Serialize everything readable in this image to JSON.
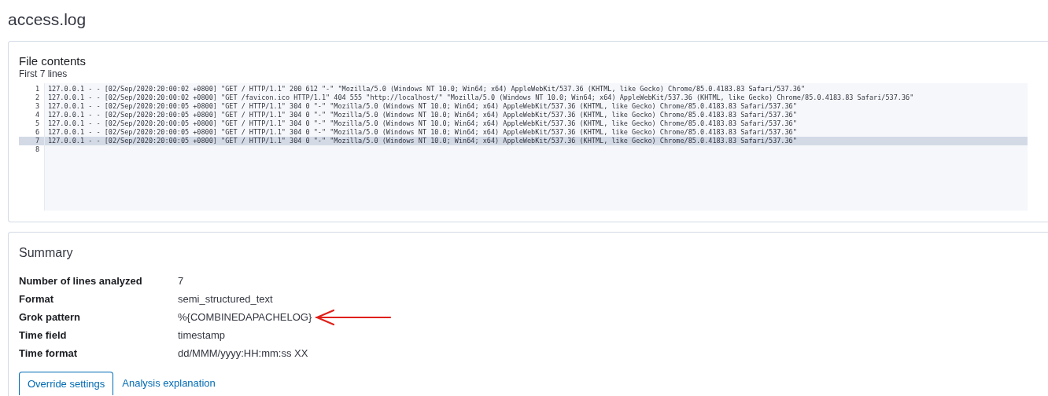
{
  "page_title": "access.log",
  "file_contents": {
    "title": "File contents",
    "subtitle": "First 7 lines",
    "lines": [
      {
        "number": "1",
        "text": "127.0.0.1 - - [02/Sep/2020:20:00:02 +0800] \"GET / HTTP/1.1\" 200 612 \"-\" \"Mozilla/5.0 (Windows NT 10.0; Win64; x64) AppleWebKit/537.36 (KHTML, like Gecko) Chrome/85.0.4183.83 Safari/537.36\"",
        "active": false
      },
      {
        "number": "2",
        "text": "127.0.0.1 - - [02/Sep/2020:20:00:02 +0800] \"GET /favicon.ico HTTP/1.1\" 404 555 \"http://localhost/\" \"Mozilla/5.0 (Windows NT 10.0; Win64; x64) AppleWebKit/537.36 (KHTML, like Gecko) Chrome/85.0.4183.83 Safari/537.36\"",
        "active": false
      },
      {
        "number": "3",
        "text": "127.0.0.1 - - [02/Sep/2020:20:00:05 +0800] \"GET / HTTP/1.1\" 304 0 \"-\" \"Mozilla/5.0 (Windows NT 10.0; Win64; x64) AppleWebKit/537.36 (KHTML, like Gecko) Chrome/85.0.4183.83 Safari/537.36\"",
        "active": false
      },
      {
        "number": "4",
        "text": "127.0.0.1 - - [02/Sep/2020:20:00:05 +0800] \"GET / HTTP/1.1\" 304 0 \"-\" \"Mozilla/5.0 (Windows NT 10.0; Win64; x64) AppleWebKit/537.36 (KHTML, like Gecko) Chrome/85.0.4183.83 Safari/537.36\"",
        "active": false
      },
      {
        "number": "5",
        "text": "127.0.0.1 - - [02/Sep/2020:20:00:05 +0800] \"GET / HTTP/1.1\" 304 0 \"-\" \"Mozilla/5.0 (Windows NT 10.0; Win64; x64) AppleWebKit/537.36 (KHTML, like Gecko) Chrome/85.0.4183.83 Safari/537.36\"",
        "active": false
      },
      {
        "number": "6",
        "text": "127.0.0.1 - - [02/Sep/2020:20:00:05 +0800] \"GET / HTTP/1.1\" 304 0 \"-\" \"Mozilla/5.0 (Windows NT 10.0; Win64; x64) AppleWebKit/537.36 (KHTML, like Gecko) Chrome/85.0.4183.83 Safari/537.36\"",
        "active": false
      },
      {
        "number": "7",
        "text": "127.0.0.1 - - [02/Sep/2020:20:00:05 +0800] \"GET / HTTP/1.1\" 304 0 \"-\" \"Mozilla/5.0 (Windows NT 10.0; Win64; x64) AppleWebKit/537.36 (KHTML, like Gecko) Chrome/85.0.4183.83 Safari/537.36\"",
        "active": true
      },
      {
        "number": "8",
        "active": false
      }
    ]
  },
  "summary": {
    "title": "Summary",
    "rows": [
      {
        "label": "Number of lines analyzed",
        "value": "7"
      },
      {
        "label": "Format",
        "value": "semi_structured_text"
      },
      {
        "label": "Grok pattern",
        "value": "%{COMBINEDAPACHELOG}",
        "annotated": true
      },
      {
        "label": "Time field",
        "value": "timestamp"
      },
      {
        "label": "Time format",
        "value": "dd/MMM/yyyy:HH:mm:ss XX"
      }
    ],
    "tabs": [
      {
        "label": "Override settings",
        "selected": true
      },
      {
        "label": "Analysis explanation",
        "selected": false
      }
    ]
  }
}
